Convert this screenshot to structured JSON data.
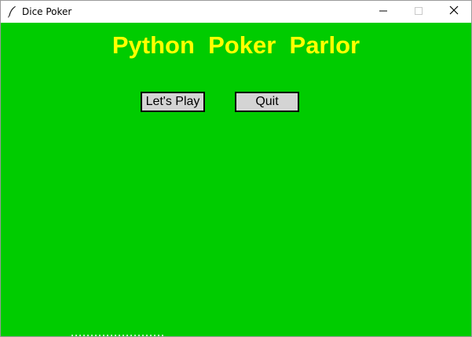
{
  "window": {
    "title": "Dice Poker",
    "app_icon": "feather-icon",
    "controls": {
      "minimize_icon": "minimize-icon",
      "maximize_icon": "maximize-icon",
      "close_icon": "close-icon"
    }
  },
  "main": {
    "title": "Python  Poker  Parlor",
    "background_color": "#00cc00",
    "title_color": "#ffff00",
    "buttons": {
      "play_label": "Let's Play",
      "quit_label": "Quit",
      "button_color": "#d4d4d4"
    }
  }
}
